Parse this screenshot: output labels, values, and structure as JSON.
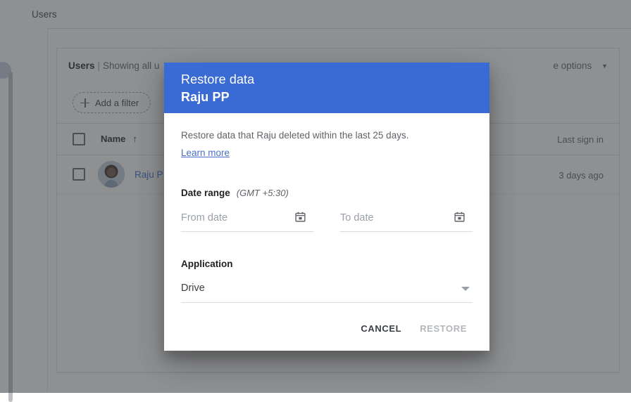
{
  "background": {
    "topbar": {
      "title": "Users"
    },
    "card": {
      "header_bold": "Users",
      "header_sep": "|",
      "header_text": "Showing all u",
      "header_hidden_1": "            ",
      "more_options_label": "e options",
      "more_options_caret": "▼",
      "add_filter_label": "Add a filter"
    },
    "table": {
      "columns": [
        {
          "label": "Name",
          "sort": "↑"
        },
        {
          "label": "Last sign in"
        }
      ],
      "rows": [
        {
          "name": "Raju P",
          "last_sign_in": "3 days ago"
        }
      ]
    }
  },
  "dialog": {
    "title": "Restore data",
    "subtitle": "Raju PP",
    "description": "Restore data that Raju deleted within the last 25 days.",
    "learn_more": "Learn more",
    "date_range": {
      "label": "Date range",
      "timezone_note": "(GMT +5:30)",
      "from_placeholder": "From date",
      "to_placeholder": "To date",
      "from_value": "",
      "to_value": ""
    },
    "application": {
      "label": "Application",
      "selected": "Drive"
    },
    "actions": {
      "cancel": "CANCEL",
      "restore": "RESTORE"
    }
  },
  "colors": {
    "dialog_header_blue": "#3a6ad4",
    "link_blue": "#4a6fc4",
    "row_link_blue": "#3c6fd1",
    "scrim": "rgba(60,64,67,0.58)",
    "disabled_text": "#b4b7ba"
  }
}
